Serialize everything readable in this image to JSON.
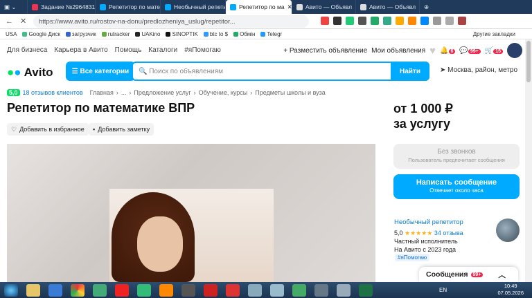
{
  "browser": {
    "tabs": [
      "Задание №2964831",
      "Репетитор по матем",
      "Необычный репетит",
      "Репетитор по ма",
      "Авито — Объявл",
      "Авито — Объявл"
    ],
    "url": "https://www.avito.ru/rostov-na-donu/predlozheniya_uslug/repetitor...",
    "bookmarks": [
      "USA",
      "Google Диск",
      "загрузчик",
      "rutracker",
      "UAKino",
      "SINOPTIK",
      "btc to $",
      "Обмін",
      "Telegr",
      "Другие закладки"
    ]
  },
  "nav": {
    "items": [
      "Для бизнеса",
      "Карьера в Авито",
      "Помощь",
      "Каталоги",
      "#яПомогаю"
    ],
    "post_ad": "Разместить объявление",
    "my_ads": "Мои объявления",
    "badges": [
      "6",
      "99+",
      "15"
    ]
  },
  "search": {
    "logo": "Avito",
    "categories": "Все категории",
    "placeholder": "Поиск по объявлениям",
    "find": "Найти",
    "city": "Москва, район, метро"
  },
  "listing": {
    "rating": "5,0",
    "reviews": "18 отзывов клиентов",
    "breadcrumbs": [
      "Главная",
      "...",
      "Предложение услуг",
      "Обучение, курсы",
      "Предметы школы и вуза"
    ],
    "title": "Репетитор по математике ВПР",
    "fav": "Добавить в избранное",
    "note": "Добавить заметку",
    "price": "от 1 000 ₽",
    "price_unit": "за услугу"
  },
  "contact": {
    "nocall": "Без звонков",
    "nocall_sub": "Пользователь предпочитает сообщения",
    "message": "Написать сообщение",
    "message_sub": "Отвечает около часа"
  },
  "seller": {
    "name": "Необычный репетитор",
    "rating": "5,0",
    "stars": "★★★★★",
    "reviews": "34 отзыва",
    "type": "Частный исполнитель",
    "since": "На Авито с 2023 года",
    "tag": "#яПомогаю"
  },
  "chat": {
    "label": "Сообщения",
    "badge": "99+"
  },
  "taskbar": {
    "lang": "EN",
    "time": "10:49",
    "date": "07.05.2026"
  }
}
